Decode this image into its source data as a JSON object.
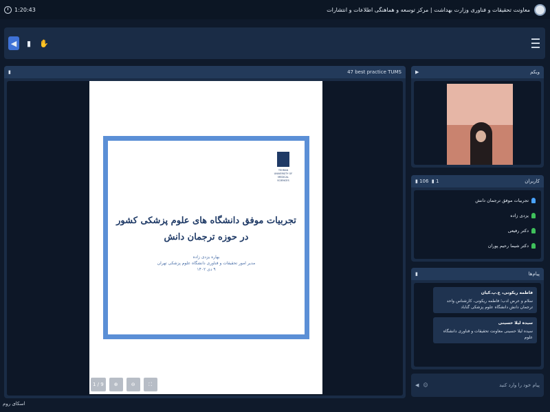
{
  "topbar": {
    "timer": "1:20:43",
    "title": "معاونت تحقیقات و فناوری وزارت بهداشت | مرکز توسعه و هماهنگی اطلاعات و انتشارات"
  },
  "presentation": {
    "panel_title": "47 best practice TUMS",
    "slide_title": "تجربیات موفق دانشگاه های علوم پزشکی کشور در حوزه ترجمان دانش",
    "presenter": "بهاره یزدی زاده",
    "presenter_role": "مدیر امور تحقیقات و فناوری دانشگاه علوم پزشکی تهران",
    "date": "۹ دی ۱۴۰۲",
    "logo_text": "TEHRAN UNIVERSITY OF MEDICAL SCIENCES",
    "page_indicator": "1 / 9"
  },
  "webcam": {
    "title": "وبکم"
  },
  "users": {
    "title": "کاربران",
    "count_total": "106",
    "count_mic": "1",
    "list": [
      {
        "name": "تجربیات موفق ترجمان دانش",
        "icon": "user-blue-icon"
      },
      {
        "name": "یزدی زاده",
        "icon": "user-green-icon"
      },
      {
        "name": "دکتر رفیعی",
        "icon": "user-green-icon"
      },
      {
        "name": "دکتر شیما رحیم پوران",
        "icon": "user-green-icon"
      }
    ]
  },
  "chat": {
    "title": "پیام‌ها",
    "messages": [
      {
        "name": "فاطمه ریکونی، ع.پ.کیان",
        "text": "سلام و عرض ادب؛ فاطمه ریکونی، کارشناس واحد ترجمان دانش دانشگاه علوم پزشکی گناباد"
      },
      {
        "name": "سیده لیلا حسینی",
        "text": "سیده لیلا حسینی معاونت تحقیقات و فناوری دانشگاه علوم"
      }
    ],
    "input_placeholder": "پیام خود را وارد کنید"
  },
  "footer": {
    "brand": "اسکای روم"
  }
}
